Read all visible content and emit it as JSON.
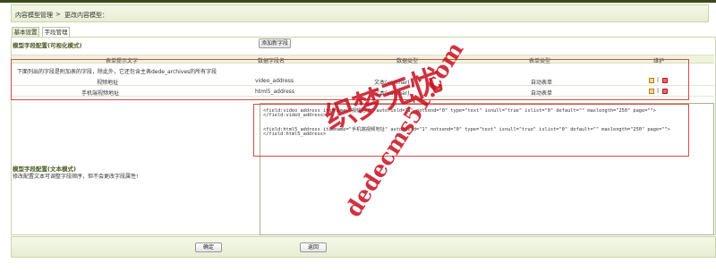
{
  "breadcrumb": {
    "part1": "内容模型管理",
    "separator": ">",
    "part2": "更改内容模型："
  },
  "tabs": [
    {
      "label": "基本设置",
      "active": false
    },
    {
      "label": "字段管理",
      "active": true
    }
  ],
  "visual_section": {
    "title": "模型字段配置(可视化模式)",
    "add_button": "添加新字段"
  },
  "table": {
    "headers": [
      "表单提示文字",
      "数据字段名",
      "数据类型",
      "表单类型",
      "维护"
    ],
    "notice": "下面列出的字段是附加表的字段，除此外，它还包含主表dede_archives的所有字段",
    "rows": [
      {
        "label": "视频地址",
        "field": "video_address",
        "type": "文本(varchar)",
        "form": "自动表单"
      },
      {
        "label": "手机端视频地址",
        "field": "html5_address",
        "type": "文本(varchar)",
        "form": "自动表单"
      }
    ],
    "action_separator": "|"
  },
  "text_section": {
    "title": "模型字段配置(文本模式)",
    "description": "修改配置文本可调整字段顺序，但不会更改字段属性!"
  },
  "code_lines": [
    "<field:video_address itemname=\"视频地址\" autofield=\"1\" notsend=\"0\" type=\"text\" isnull=\"true\" islist=\"0\" default=\"\"  maxlength=\"250\" page=\"\">",
    "</field:video_address>",
    "",
    "<field:html5_address itemname=\"手机端视频地址\" autofield=\"1\" notsend=\"0\" type=\"text\" isnull=\"true\" islist=\"0\" default=\"\"  maxlength=\"250\" page=\"\">",
    "</field:html5_address>"
  ],
  "footer": {
    "ok_button": "确定",
    "back_button": "返回"
  },
  "watermark": {
    "cjk": "织梦无忧",
    "domain": "dedecms51.com",
    "color": "#c80f1e"
  }
}
